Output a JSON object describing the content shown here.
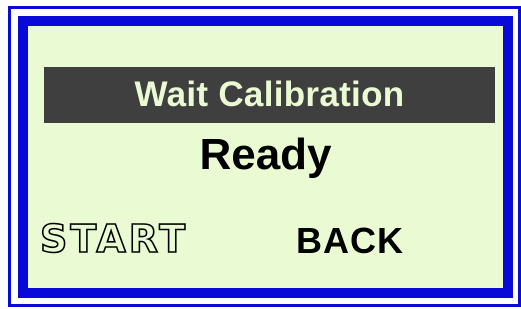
{
  "screen": {
    "header": "Wait Calibration",
    "status": "Ready",
    "buttons": {
      "start_label": "START",
      "back_label": "BACK"
    }
  },
  "colors": {
    "frame": "#0a0ad8",
    "lcd_background": "#eafbd3",
    "header_bar": "#3f3f3f",
    "text": "#000000"
  }
}
